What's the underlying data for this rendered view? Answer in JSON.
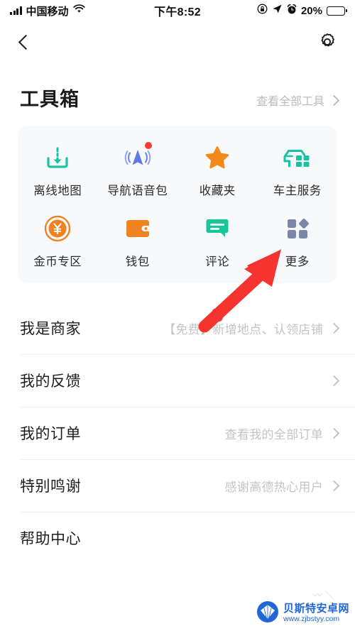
{
  "statusbar": {
    "carrier": "中国移动",
    "time": "下午8:52",
    "battery_pct": "20%",
    "icons": [
      "signal-bars-icon",
      "wifi-icon",
      "rotation-lock-icon",
      "location-arrow-icon",
      "alarm-clock-icon",
      "battery-icon"
    ]
  },
  "navbar": {
    "back_icon": "back-chevron-icon",
    "settings_icon": "gear-icon"
  },
  "section": {
    "title": "工具箱",
    "more_label": "查看全部工具"
  },
  "tools": [
    [
      {
        "label": "离线地图",
        "icon": "offline-map-download-icon",
        "color": "#19c2a3",
        "badge": false
      },
      {
        "label": "导航语音包",
        "icon": "navigation-voice-icon",
        "color": "#5c7ce6",
        "badge": true
      },
      {
        "label": "收藏夹",
        "icon": "star-favorites-icon",
        "color": "#f28a1b",
        "badge": false
      },
      {
        "label": "车主服务",
        "icon": "car-service-icon",
        "color": "#19c2a3",
        "badge": false
      }
    ],
    [
      {
        "label": "金币专区",
        "icon": "gold-coin-icon",
        "color": "#f08320",
        "badge": false
      },
      {
        "label": "钱包",
        "icon": "wallet-icon",
        "color": "#f08320",
        "badge": false
      },
      {
        "label": "评论",
        "icon": "comment-bubble-icon",
        "color": "#17c79a",
        "badge": false
      },
      {
        "label": "更多",
        "icon": "more-grid-icon",
        "color": "#7b87a8",
        "badge": false
      }
    ]
  ],
  "list": [
    {
      "label": "我是商家",
      "sub": "【免费】新增地点、认领店铺"
    },
    {
      "label": "我的反馈",
      "sub": ""
    },
    {
      "label": "我的订单",
      "sub": "查看我的全部订单"
    },
    {
      "label": "特别鸣谢",
      "sub": "感谢高德热心用户"
    },
    {
      "label": "帮助中心",
      "sub": ""
    }
  ],
  "annotation": {
    "arrow_color": "#f5342f",
    "points_at": "更多"
  },
  "watermark": {
    "name": "贝斯特安卓网",
    "url": "www.zjbstyy.com",
    "color": "#1a62d6"
  }
}
